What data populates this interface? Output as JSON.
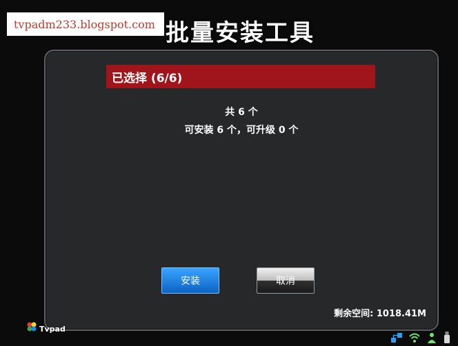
{
  "watermark": "tvpadm233.blogspot.com",
  "app": {
    "title": "批量安装工具"
  },
  "dialog": {
    "header": "已选择 (6/6)",
    "summary_total": "共 6 个",
    "summary_detail": "可安装 6 个，可升级 0 个",
    "install_label": "安装",
    "cancel_label": "取消",
    "storage": "剩余空间: 1018.41M"
  },
  "brand": {
    "logo_text": "Tvpad"
  },
  "status_bar": {
    "icons": [
      "network-icon",
      "wifi-icon",
      "user-icon",
      "usb-icon"
    ]
  },
  "colors": {
    "header": "#a0151b",
    "accent": "#1a7fe0",
    "background": "#262829"
  }
}
